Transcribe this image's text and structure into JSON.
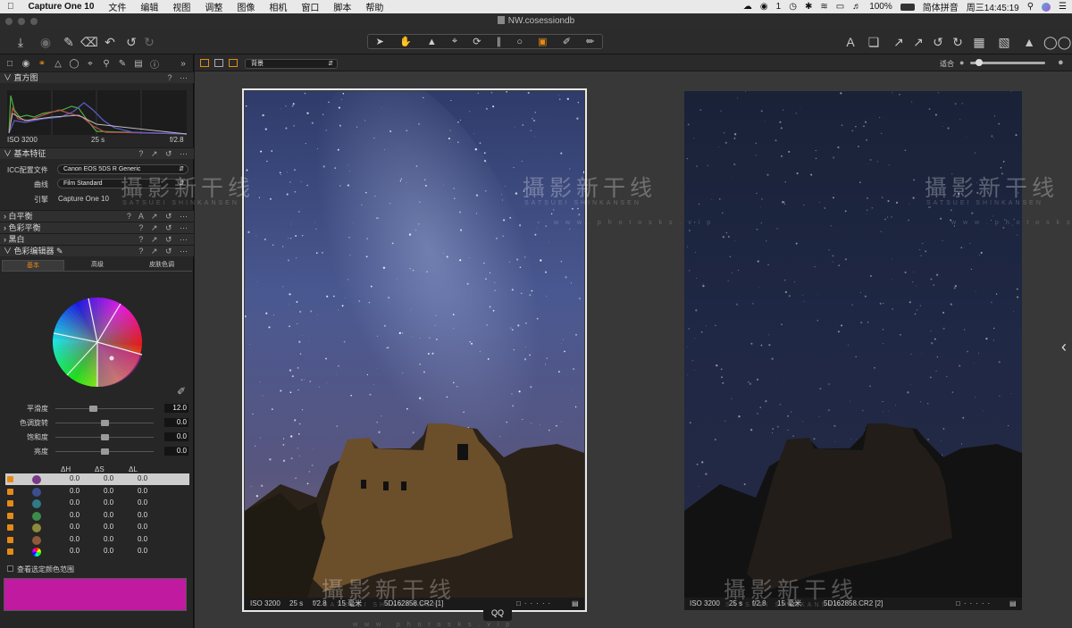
{
  "menubar": {
    "app_name": "Capture One 10",
    "items": [
      "文件",
      "编辑",
      "视图",
      "调整",
      "图像",
      "相机",
      "窗口",
      "脚本",
      "帮助"
    ],
    "status": {
      "notification_count": "1",
      "battery": "100%",
      "input_method": "简体拼音",
      "clock": "周三14:45:19"
    }
  },
  "window": {
    "title": "NW.cosessiondb"
  },
  "viewer_bar": {
    "layout_select": "背景",
    "zoom_label": "适合"
  },
  "tools": {
    "histogram": {
      "title": "直方图",
      "iso": "ISO 3200",
      "shutter": "25 s",
      "aperture": "f/2.8"
    },
    "basic": {
      "title": "基本特征",
      "icc_label": "ICC配置文件",
      "icc_value": "Canon EOS 5DS R Generic",
      "curve_label": "曲线",
      "curve_value": "Film Standard",
      "engine_label": "引擎",
      "engine_value": "Capture One 10"
    },
    "white_balance": {
      "title": "白平衡"
    },
    "color_balance": {
      "title": "色彩平衡"
    },
    "bw": {
      "title": "黑白"
    },
    "color_editor": {
      "title": "色彩编辑器",
      "tabs": [
        "基本",
        "高级",
        "皮肤色调"
      ],
      "sliders": [
        {
          "label": "平滑度",
          "value": "12.0",
          "pos": 0.38
        },
        {
          "label": "色调旋转",
          "value": "0.0",
          "pos": 0.5
        },
        {
          "label": "饱和度",
          "value": "0.0",
          "pos": 0.5
        },
        {
          "label": "亮度",
          "value": "0.0",
          "pos": 0.5
        }
      ],
      "table_headers": [
        "ΔH",
        "ΔS",
        "ΔL"
      ],
      "rows": [
        {
          "color": "#7a3a8a",
          "dh": "0.0",
          "ds": "0.0",
          "dl": "0.0"
        },
        {
          "color": "#3b4e8f",
          "dh": "0.0",
          "ds": "0.0",
          "dl": "0.0"
        },
        {
          "color": "#2f7a86",
          "dh": "0.0",
          "ds": "0.0",
          "dl": "0.0"
        },
        {
          "color": "#3d8c4a",
          "dh": "0.0",
          "ds": "0.0",
          "dl": "0.0"
        },
        {
          "color": "#8d8a3a",
          "dh": "0.0",
          "ds": "0.0",
          "dl": "0.0"
        },
        {
          "color": "#8f5a3a",
          "dh": "0.0",
          "ds": "0.0",
          "dl": "0.0"
        },
        {
          "color": "rainbow",
          "dh": "0.0",
          "ds": "0.0",
          "dl": "0.0"
        }
      ],
      "view_range_label": "查看选定颜色范围",
      "swatch_color": "#c01aa0"
    }
  },
  "photos": [
    {
      "iso": "ISO 3200",
      "shutter": "25 s",
      "aperture": "f/2.8",
      "focal": "15 毫米",
      "filename": "5D162858.CR2 [1]"
    },
    {
      "iso": "ISO 3200",
      "shutter": "25 s",
      "aperture": "f/2.8",
      "focal": "15 毫米",
      "filename": "5D162858.CR2 [2]"
    }
  ],
  "qq_label": "QQ",
  "watermark": {
    "main": "攝影新干线",
    "sub": "SATSUEI SHINKANSEN",
    "url": "w w w . p h o t o s k s . v i p"
  }
}
